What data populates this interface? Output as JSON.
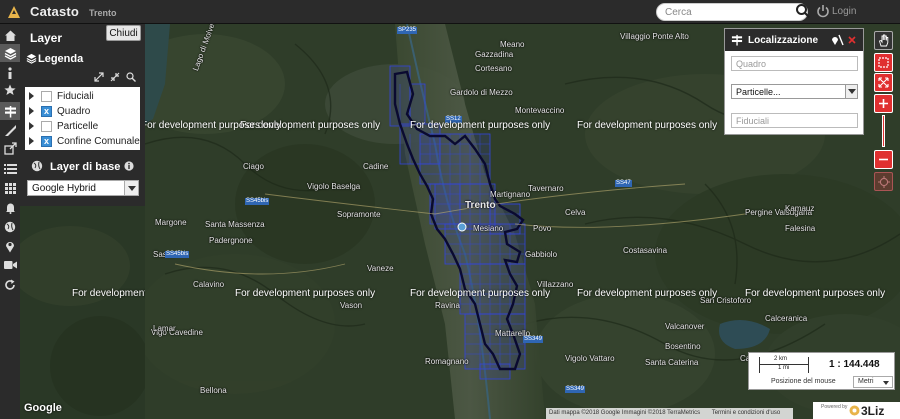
{
  "header": {
    "app_title": "Catasto",
    "app_subtitle": "Trento",
    "search_placeholder": "Cerca",
    "login_label": "Login"
  },
  "layer_panel": {
    "title": "Layer",
    "close_label": "Chiudi",
    "legend_title": "Legenda",
    "layers": [
      {
        "label": "Fiduciali",
        "checked": false
      },
      {
        "label": "Quadro",
        "checked": true
      },
      {
        "label": "Particelle",
        "checked": false
      },
      {
        "label": "Confine Comunale",
        "checked": true
      }
    ],
    "base_title": "Layer di base",
    "base_value": "Google Hybrid"
  },
  "localizzazione": {
    "title": "Localizzazione",
    "quadro_placeholder": "Quadro",
    "particelle_value": "Particelle...",
    "fiduciali_placeholder": "Fiduciali"
  },
  "map": {
    "watermark": "For development purposes only",
    "places": [
      "Lago di Molveno",
      "Villaggio Ponte Alto",
      "Meano",
      "Gazzadina",
      "Cortesano",
      "Gardolo di Mezzo",
      "Montevaccino",
      "Ciago",
      "Cadine",
      "Vigolo Baselga",
      "Sopramonte",
      "Margone",
      "Santa Massenza",
      "Padergnone",
      "Trento",
      "Martignano",
      "Tavernaro",
      "Celva",
      "Povo",
      "Mesiano",
      "Gabbiolo",
      "Pergine Valsugana",
      "Costasavina",
      "Falesina",
      "Vaneze",
      "Vason",
      "Ravina",
      "Villazzano",
      "Mattarello",
      "Romagnano",
      "Vigolo Vattaro",
      "Bosentino",
      "Caldonazzo",
      "San Cristoforo",
      "Vigo Cavedine",
      "Bellona",
      "Calavino",
      "Sasso",
      "Lamar",
      "Kamauz",
      "Calceranica",
      "Valcanover",
      "Santa Caterina"
    ],
    "road_labels": [
      "SP235",
      "SS12",
      "SS45bis",
      "SS47",
      "SS349",
      "SS45bis",
      "SS349"
    ]
  },
  "scale": {
    "bar_km": "2 km",
    "bar_mi": "1 mi",
    "ratio": "1 : 144.448",
    "mouse_position_label": "Posizione del mouse",
    "units": "Metri"
  },
  "attribution": {
    "google_logo": "Google",
    "data": "Dati mappa ©2018 Google Immagini ©2018 TerraMetrics",
    "terms": "Termini e condizioni d'uso",
    "powered_by": "Powered by",
    "brand": "3Liz"
  },
  "colors": {
    "header_bg": "#2b2b2b",
    "accent_red": "#e03030",
    "checkbox_blue": "#3a8fd6",
    "grid_blue": "#3344dd",
    "boundary": "#0a0a30"
  }
}
